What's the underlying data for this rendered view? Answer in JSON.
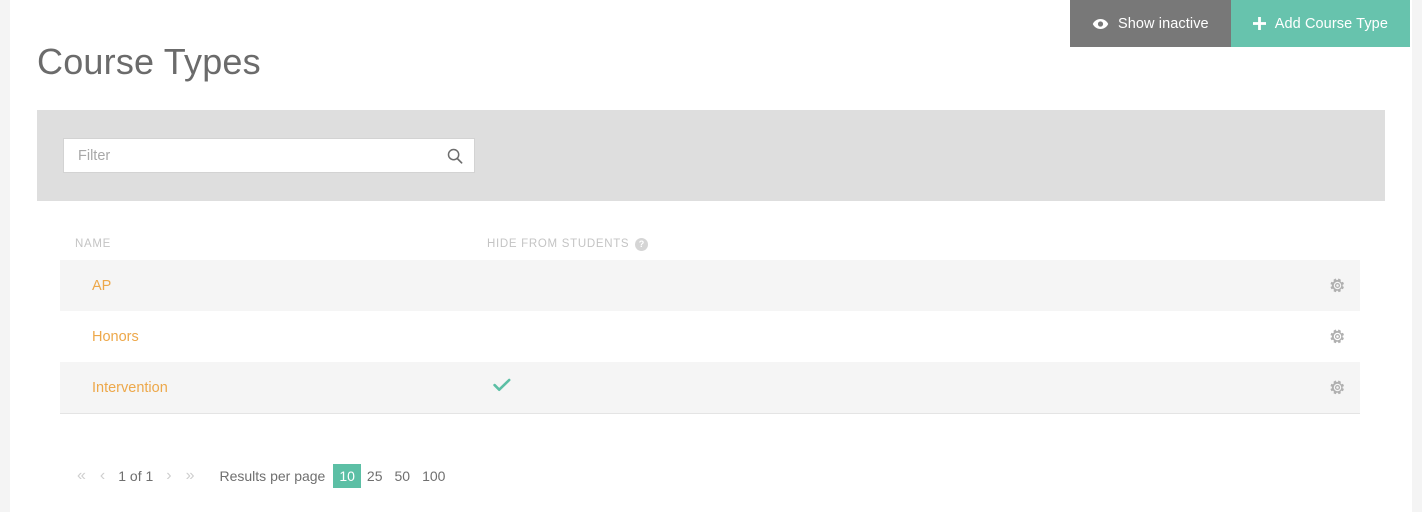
{
  "header": {
    "title": "Course Types",
    "actions": [
      {
        "label": "Show inactive",
        "icon": "eye-icon",
        "style": "secondary",
        "color": "#787878"
      },
      {
        "label": "Add Course Type",
        "icon": "plus-icon",
        "style": "primary",
        "color": "#67c3ad"
      }
    ]
  },
  "filter": {
    "placeholder": "Filter",
    "value": "",
    "search_icon": "search-icon"
  },
  "table": {
    "columns": [
      {
        "label": "Name",
        "key": "name"
      },
      {
        "label": "Hide from students",
        "key": "hide_from_students",
        "help_icon": "help-icon",
        "help_glyph": "?"
      },
      {
        "label": "",
        "key": "actions"
      }
    ],
    "rows": [
      {
        "name": "AP",
        "hide_from_students": false,
        "action_icon": "gear-icon"
      },
      {
        "name": "Honors",
        "hide_from_students": false,
        "action_icon": "gear-icon"
      },
      {
        "name": "Intervention",
        "hide_from_students": true,
        "action_icon": "gear-icon"
      }
    ]
  },
  "pagination": {
    "first_label": "«",
    "prev_label": "‹",
    "page_label": "1 of 1",
    "next_label": "›",
    "last_label": "»",
    "results_per_page_label": "Results per page",
    "options": [
      "10",
      "25",
      "50",
      "100"
    ],
    "selected": "10"
  },
  "colors": {
    "accent_teal": "#5cbfa5",
    "button_teal": "#67c3ad",
    "button_gray": "#787878",
    "link_orange": "#eda84a",
    "title_gray": "#6b6b6b",
    "panel_gray": "#dedede",
    "row_stripe": "#f5f5f5"
  }
}
